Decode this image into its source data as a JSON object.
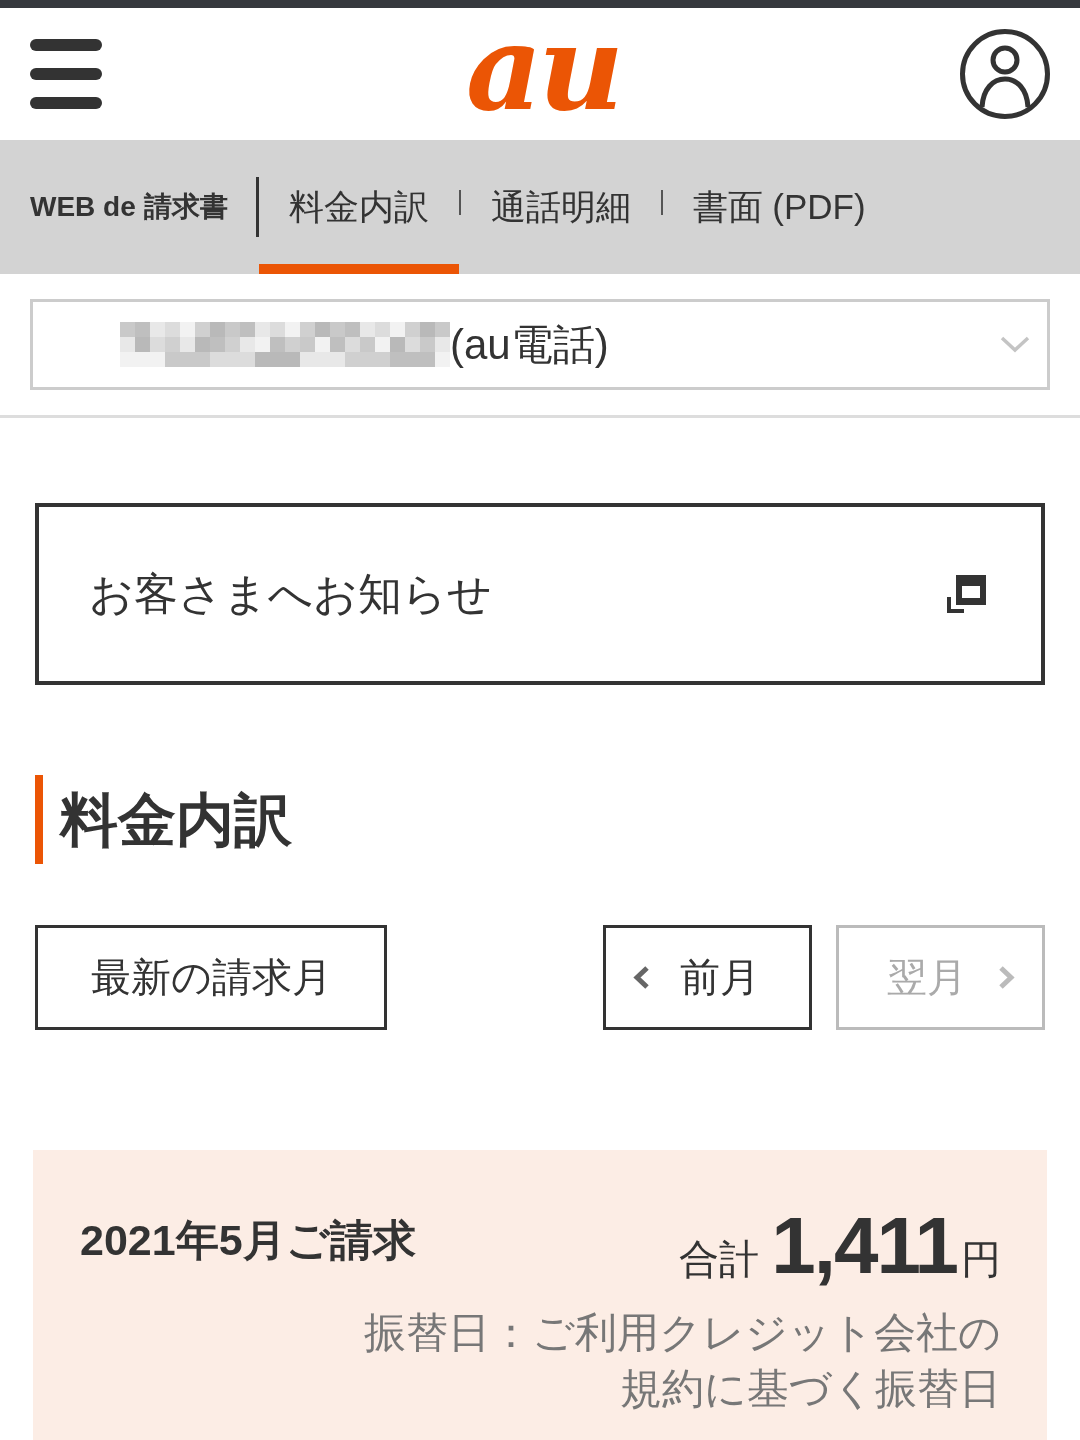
{
  "header": {
    "logo": "au"
  },
  "billing_nav": {
    "title": "WEB de 請求書",
    "tabs": [
      {
        "label": "料金内訳",
        "selected": true
      },
      {
        "label": "通話明細",
        "selected": false
      },
      {
        "label": "書面 (PDF)",
        "selected": false
      }
    ]
  },
  "line_select": {
    "number_redacted": true,
    "value": "(au電話)"
  },
  "notice": {
    "label": "お客さまへお知らせ"
  },
  "section": {
    "title": "料金内訳"
  },
  "month_nav": {
    "buttons": [
      {
        "kind": "latest",
        "label": "最新の請求月",
        "disabled": false
      },
      {
        "kind": "prev",
        "label": "前月",
        "disabled": false
      },
      {
        "kind": "next",
        "label": "翌月",
        "disabled": true
      }
    ]
  },
  "bill": {
    "month": "2021年5月ご請求",
    "total_label": "合計",
    "total_amount": "1,411",
    "currency": "円",
    "transfer_note": "振替日：ご利用クレジット会社の規約に基づく振替日"
  }
}
